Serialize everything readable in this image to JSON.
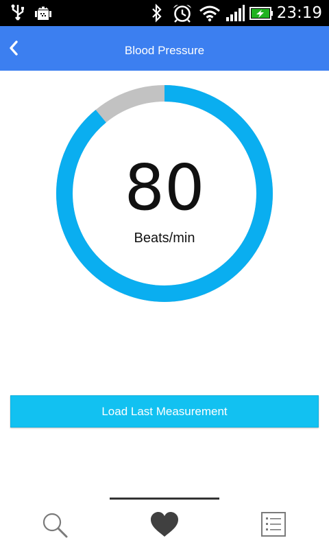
{
  "status_bar": {
    "time": "23:19",
    "icons": [
      "usb-icon",
      "android-debug-icon",
      "bluetooth-icon",
      "alarm-icon",
      "wifi-icon",
      "signal-icon",
      "battery-charging-icon"
    ]
  },
  "app_bar": {
    "title": "Blood Pressure",
    "back_icon": "chevron-left-icon"
  },
  "gauge": {
    "value": "80",
    "unit": "Beats/min",
    "fill_fraction": 0.89,
    "colors": {
      "fill": "#0aaef0",
      "track": "#c2c2c2"
    }
  },
  "actions": {
    "load_label": "Load Last Measurement",
    "button_color": "#12c1f1"
  },
  "bottom_nav": {
    "items": [
      {
        "icon": "search-icon",
        "selected": false
      },
      {
        "icon": "heart-icon",
        "selected": true
      },
      {
        "icon": "list-icon",
        "selected": false
      }
    ]
  },
  "colors": {
    "app_bar": "#3c7ff0",
    "status_bar": "#000000"
  }
}
